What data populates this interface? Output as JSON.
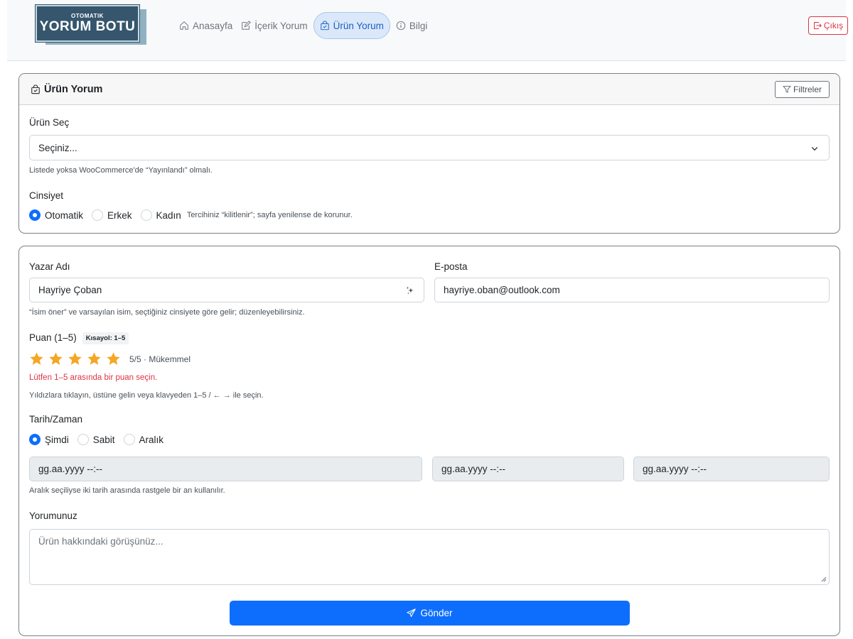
{
  "brand": {
    "line1": "OTOMATIK",
    "line2": "YORUM BOTU"
  },
  "nav": {
    "items": [
      {
        "label": "Anasayfa",
        "icon": "home-icon",
        "active": false
      },
      {
        "label": "İçerik Yorum",
        "icon": "edit-icon",
        "active": false
      },
      {
        "label": "Ürün Yorum",
        "icon": "bag-check-icon",
        "active": true
      },
      {
        "label": "Bilgi",
        "icon": "info-icon",
        "active": false
      }
    ],
    "logout_label": "Çıkış"
  },
  "product_card": {
    "title": "Ürün Yorum",
    "filter_label": "Filtreler",
    "product_label": "Ürün Seç",
    "product_value": "Seçiniz...",
    "product_help": "Listede yoksa WooCommerce'de “Yayınlandı” olmalı.",
    "gender_label": "Cinsiyet",
    "gender_options": [
      "Otomatik",
      "Erkek",
      "Kadın"
    ],
    "gender_selected": "Otomatik",
    "gender_help": "Tercihiniz “kilitlenir”; sayfa yenilense de korunur."
  },
  "review_form": {
    "author_label": "Yazar Adı",
    "author_value": "Hayriye Çoban",
    "email_label": "E-posta",
    "email_value": "hayriye.oban@outlook.com",
    "author_help": "“İsim öner” ve varsayılan isim, seçtiğiniz cinsiyete göre gelir; düzenleyebilirsiniz.",
    "rating_label": "Puan (1–5)",
    "rating_badge": "Kısayol: 1–5",
    "rating_value": 5,
    "rating_max": 5,
    "rating_text": "5/5 · Mükemmel",
    "rating_error": "Lütfen 1–5 arasında bir puan seçin.",
    "rating_help": "Yıldızlara tıklayın, üstüne gelin veya klavyeden 1–5 / ← → ile seçin.",
    "datetime_label": "Tarih/Zaman",
    "datetime_options": [
      "Şimdi",
      "Sabit",
      "Aralık"
    ],
    "datetime_selected": "Şimdi",
    "date_placeholder_1": "gg.aa.yyyy --:--",
    "date_placeholder_2": "gg.aa.yyyy --:--",
    "date_placeholder_3": "gg.aa.yyyy --:--",
    "date_help": "Aralık seçiliyse iki tarih arasında rastgele bir an kullanılır.",
    "comment_label": "Yorumunuz",
    "comment_placeholder": "Ürün hakkındaki görüşünüz...",
    "submit_label": "Gönder"
  },
  "colors": {
    "primary": "#0d6efd",
    "danger": "#dc3545",
    "star": "#f5a623",
    "brand": "#35566d"
  }
}
